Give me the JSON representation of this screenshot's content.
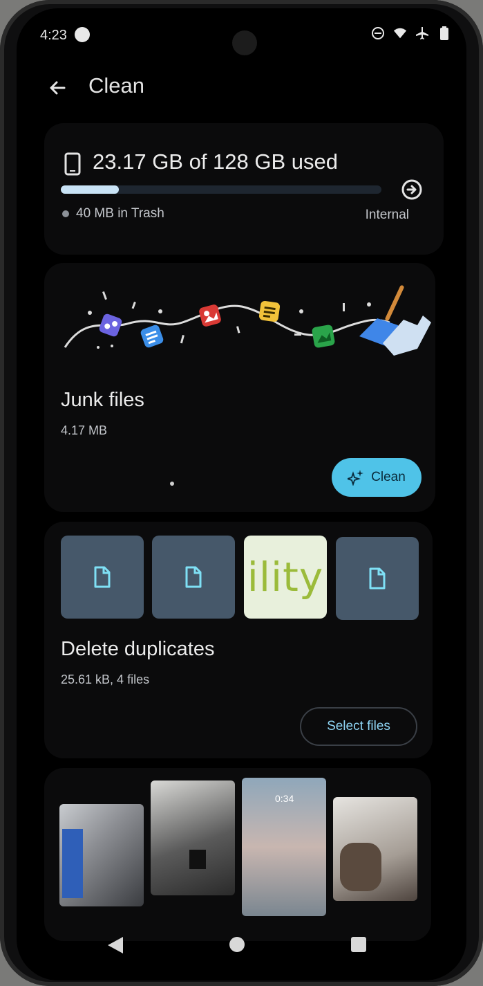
{
  "status_bar": {
    "time": "4:23",
    "icons": [
      "dnd-icon",
      "wifi-icon",
      "airplane-icon",
      "battery-icon"
    ]
  },
  "header": {
    "title": "Clean",
    "back_icon": "arrow-back-icon"
  },
  "storage": {
    "title": "23.17 GB of 128 GB used",
    "used_fraction": 0.18,
    "trash_label": "40 MB in Trash",
    "location_label": "Internal",
    "icon": "phone-storage-icon"
  },
  "junk": {
    "title": "Junk files",
    "size": "4.17 MB",
    "button_label": "Clean",
    "button_icon": "sparkle-icon"
  },
  "duplicates": {
    "title": "Delete duplicates",
    "meta": "25.61 kB, 4 files",
    "button_label": "Select files",
    "thumbnails": [
      {
        "type": "file",
        "icon": "file-icon"
      },
      {
        "type": "file",
        "icon": "file-icon"
      },
      {
        "type": "image",
        "text": "ility"
      },
      {
        "type": "file",
        "icon": "file-icon"
      }
    ]
  },
  "photos": {
    "items": [
      {
        "name": "photo-1"
      },
      {
        "name": "photo-2"
      },
      {
        "name": "photo-3",
        "text": "0:34"
      },
      {
        "name": "photo-4"
      }
    ]
  },
  "colors": {
    "accent": "#4fc3e8",
    "progress_fill": "#c9e3f6",
    "card": "#0b0b0c",
    "text_primary": "#ececec",
    "text_secondary": "#c4c7cc"
  }
}
